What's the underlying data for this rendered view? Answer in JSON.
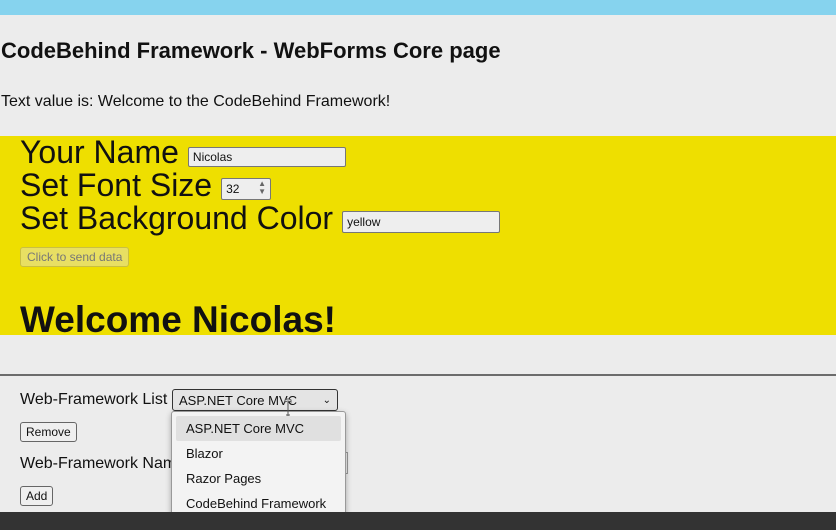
{
  "page": {
    "title": "CodeBehind Framework - WebForms Core page",
    "text_value": "Text value is: Welcome to the CodeBehind Framework!"
  },
  "form": {
    "name_label": "Your Name",
    "name_value": "Nicolas",
    "font_size_label": "Set Font Size",
    "font_size_value": "32",
    "bg_color_label": "Set Background Color",
    "bg_color_value": "yellow",
    "send_button": "Click to send data",
    "welcome": "Welcome Nicolas!",
    "background_color": "#eedf00"
  },
  "framework": {
    "list_label": "Web-Framework List",
    "selected": "ASP.NET Core MVC",
    "remove_button": "Remove",
    "name_label": "Web-Framework Nam",
    "add_button": "Add",
    "options": [
      "ASP.NET Core MVC",
      "Blazor",
      "Razor Pages",
      "CodeBehind Framework"
    ]
  },
  "colors": {
    "top_bar": "#86d3ee",
    "page_background": "#ececec",
    "footer": "#333333"
  }
}
